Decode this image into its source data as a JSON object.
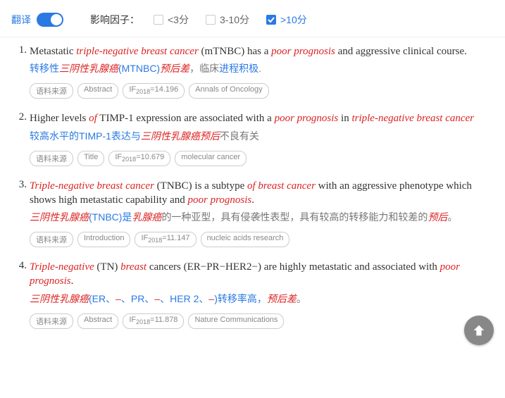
{
  "header": {
    "translate_label": "翻译",
    "filter_label": "影响因子：",
    "options": [
      {
        "label": "<3分",
        "checked": false
      },
      {
        "label": "3-10分",
        "checked": false
      },
      {
        "label": ">10分",
        "checked": true
      }
    ]
  },
  "tag_labels": {
    "source": "语料来源",
    "if_prefix": "IF",
    "if_year": "2018"
  },
  "results": [
    {
      "num": "1.",
      "en_parts": [
        {
          "t": "Metastatic ",
          "c": "n"
        },
        {
          "t": "triple-negative breast cancer",
          "c": "hl"
        },
        {
          "t": " (mTNBC) has a ",
          "c": "n"
        },
        {
          "t": "poor prognosis",
          "c": "hl"
        },
        {
          "t": " and aggressive clinical course.",
          "c": "n"
        }
      ],
      "cn_parts": [
        {
          "t": "转移性",
          "c": "n"
        },
        {
          "t": "三阴性乳腺癌",
          "c": "hl"
        },
        {
          "t": "(MTNBC)",
          "c": "n"
        },
        {
          "t": "预后差",
          "c": "hl"
        },
        {
          "t": "，临床",
          "c": "g"
        },
        {
          "t": "进程积极",
          "c": "n"
        },
        {
          "t": ".",
          "c": "g"
        }
      ],
      "section": "Abstract",
      "if": "14.196",
      "journal": "Annals of Oncology"
    },
    {
      "num": "2.",
      "en_parts": [
        {
          "t": "Higher levels ",
          "c": "n"
        },
        {
          "t": "of",
          "c": "hl"
        },
        {
          "t": " TIMP-1 expression are associated with a ",
          "c": "n"
        },
        {
          "t": "poor prognosis",
          "c": "hl"
        },
        {
          "t": " in ",
          "c": "n"
        },
        {
          "t": "triple-negative breast cancer",
          "c": "hl"
        }
      ],
      "cn_parts": [
        {
          "t": "较高水平的TIMP-1表达与",
          "c": "n"
        },
        {
          "t": "三阴性乳腺癌预后",
          "c": "hl"
        },
        {
          "t": "不良有关",
          "c": "g"
        }
      ],
      "section": "Title",
      "if": "10.679",
      "journal": "molecular cancer"
    },
    {
      "num": "3.",
      "en_parts": [
        {
          "t": "Triple-negative breast cancer",
          "c": "hl"
        },
        {
          "t": " (TNBC) is a subtype ",
          "c": "n"
        },
        {
          "t": "of breast cancer",
          "c": "hl"
        },
        {
          "t": " with an aggressive phenotype which shows high metastatic capability and ",
          "c": "n"
        },
        {
          "t": "poor prognosis",
          "c": "hl"
        },
        {
          "t": ".",
          "c": "n"
        }
      ],
      "cn_parts": [
        {
          "t": "三阴性乳腺癌",
          "c": "hl"
        },
        {
          "t": "(TNBC)是",
          "c": "n"
        },
        {
          "t": "乳腺癌",
          "c": "hl"
        },
        {
          "t": "的一种亚型，具有侵袭性表型，具有较高的转移能力和较差的",
          "c": "g"
        },
        {
          "t": "预后",
          "c": "hl"
        },
        {
          "t": "。",
          "c": "g"
        }
      ],
      "section": "Introduction",
      "if": "11.147",
      "journal": "nucleic acids research"
    },
    {
      "num": "4.",
      "en_parts": [
        {
          "t": "Triple-negative",
          "c": "hl"
        },
        {
          "t": " (TN) ",
          "c": "n"
        },
        {
          "t": "breast",
          "c": "hl"
        },
        {
          "t": " cancers (ER−PR−HER2−) are highly metastatic and associated with ",
          "c": "n"
        },
        {
          "t": "poor prognosis",
          "c": "hl"
        },
        {
          "t": ".",
          "c": "n"
        }
      ],
      "cn_parts": [
        {
          "t": "三阴性乳腺癌",
          "c": "hl"
        },
        {
          "t": "(ER、",
          "c": "n"
        },
        {
          "t": "–",
          "c": "hl"
        },
        {
          "t": "、PR、",
          "c": "n"
        },
        {
          "t": "–",
          "c": "hl"
        },
        {
          "t": "、HER 2、",
          "c": "n"
        },
        {
          "t": "–",
          "c": "hl"
        },
        {
          "t": ")转移率高，",
          "c": "n"
        },
        {
          "t": "预后差",
          "c": "hl"
        },
        {
          "t": "。",
          "c": "g"
        }
      ],
      "section": "Abstract",
      "if": "11.878",
      "journal": "Nature Communications"
    }
  ]
}
